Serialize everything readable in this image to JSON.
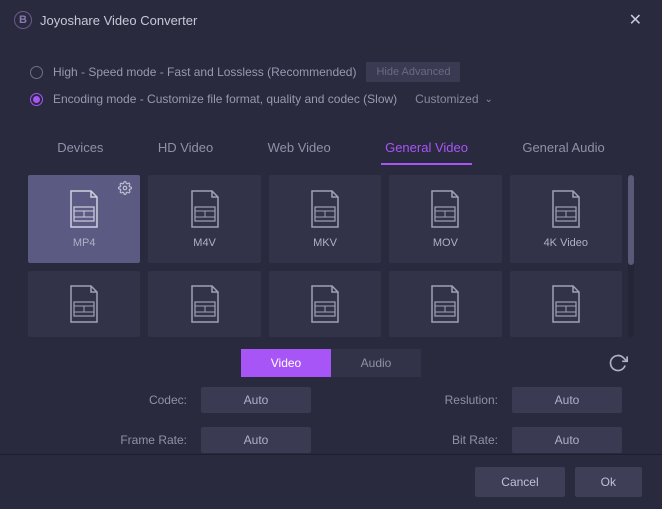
{
  "titlebar": {
    "title": "Joyoshare Video Converter"
  },
  "options": {
    "high_speed_label": "High - Speed mode - Fast and Lossless (Recommended)",
    "hide_advanced": "Hide Advanced",
    "encoding_label": "Encoding mode - Customize file format, quality and codec (Slow)",
    "customized_label": "Customized"
  },
  "tabs": [
    "Devices",
    "HD Video",
    "Web Video",
    "General Video",
    "General Audio"
  ],
  "active_tab": "General Video",
  "formats_row1": [
    "MP4",
    "M4V",
    "MKV",
    "MOV",
    "4K Video"
  ],
  "selected_format": "MP4",
  "subtabs": [
    "Video",
    "Audio"
  ],
  "active_subtab": "Video",
  "settings": {
    "codec": {
      "label": "Codec:",
      "value": "Auto"
    },
    "resolution": {
      "label": "Reslution:",
      "value": "Auto"
    },
    "framerate": {
      "label": "Frame Rate:",
      "value": "Auto"
    },
    "bitrate": {
      "label": "Bit Rate:",
      "value": "Auto"
    }
  },
  "footer": {
    "cancel": "Cancel",
    "ok": "Ok"
  }
}
